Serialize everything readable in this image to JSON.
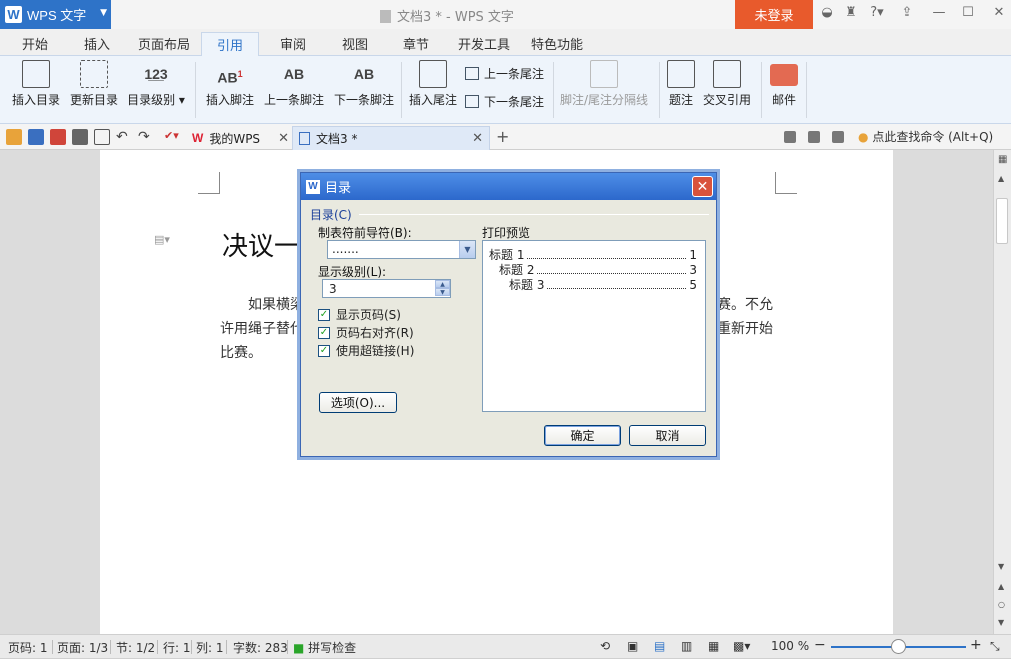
{
  "app": {
    "name": "WPS 文字",
    "doc_title": "文档3 * - WPS 文字",
    "login": "未登录"
  },
  "menu": [
    "开始",
    "插入",
    "页面布局",
    "引用",
    "审阅",
    "视图",
    "章节",
    "开发工具",
    "特色功能"
  ],
  "menu_active": "引用",
  "ribbon": {
    "insert_toc": "插入目录",
    "update_toc": "更新目录",
    "toc_level": "目录级别",
    "insert_footnote": "插入脚注",
    "prev_footnote": "上一条脚注",
    "next_footnote": "下一条脚注",
    "insert_endnote": "插入尾注",
    "prev_endnote": "上一条尾注",
    "next_endnote": "下一条尾注",
    "separator": "脚注/尾注分隔线",
    "caption": "题注",
    "cross_ref": "交叉引用",
    "mail": "邮件"
  },
  "tabs": {
    "my_wps": "我的WPS",
    "doc": "文档3 *"
  },
  "search_cmd": "点此查找命令 (Alt+Q)",
  "document": {
    "heading": "决议一",
    "line1_left": "如果横梁",
    "line1_right": "赛。不允",
    "line2_left": "许用绳子替代",
    "line2_right": "重新开始",
    "line3": "比赛。"
  },
  "status": {
    "page": "页码: 1",
    "pages": "页面: 1/3",
    "section": "节: 1/2",
    "row": "行: 1",
    "col": "列: 1",
    "words": "字数: 283",
    "spell": "拼写检查",
    "zoom": "100 %"
  },
  "dialog": {
    "title": "目录",
    "group": "目录(C)",
    "leader_label": "制表符前导符(B):",
    "leader_value": ".......",
    "levels_label": "显示级别(L):",
    "levels_value": "3",
    "show_page": "显示页码(S)",
    "align_right": "页码右对齐(R)",
    "hyperlink": "使用超链接(H)",
    "options": "选项(O)...",
    "preview_label": "打印预览",
    "preview": [
      {
        "text": "标题 1",
        "page": "1"
      },
      {
        "text": "标题 2",
        "page": "3"
      },
      {
        "text": "标题 3",
        "page": "5"
      }
    ],
    "ok": "确定",
    "cancel": "取消"
  }
}
